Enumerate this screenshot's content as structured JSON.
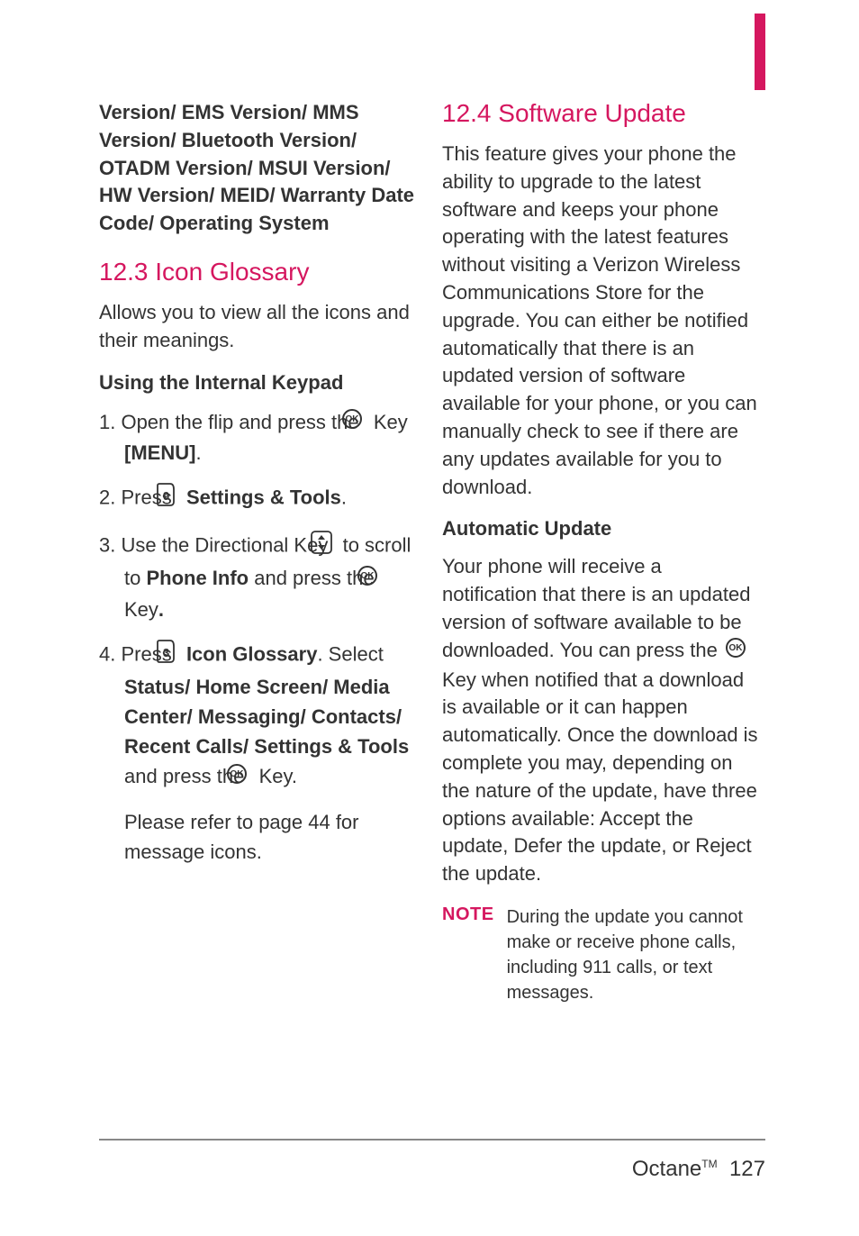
{
  "leftCol": {
    "versionList": "Version/ EMS Version/ MMS Version/ Bluetooth Version/ OTADM Version/ MSUI Version/ HW Version/ MEID/ Warranty Date Code/ Operating System",
    "heading_12_3": "12.3 Icon Glossary",
    "intro_12_3": "Allows you to view all the icons and their meanings.",
    "subhead_keypad": "Using the Internal Keypad",
    "step1_a": "1. Open the flip and press the ",
    "step1_b": " Key ",
    "step1_menu": "[MENU]",
    "step1_c": ".",
    "step2_a": "2. Press ",
    "step2_b": " Settings & Tools",
    "step2_c": ".",
    "step3_a": "3. Use the Directional Key ",
    "step3_b": " to scroll to ",
    "step3_phoneinfo": "Phone Info",
    "step3_c": " and press the ",
    "step3_d": " Key",
    "step3_e": ".",
    "step4_a": "4. Press ",
    "step4_icon_glossary": " Icon Glossary",
    "step4_b": ". Select ",
    "step4_selects": "Status/ Home Screen/ Media Center/ Messaging/ Contacts/ Recent Calls/ Settings & Tools",
    "step4_c": " and press the ",
    "step4_d": " Key.",
    "refer": "Please refer to page 44 for message icons."
  },
  "rightCol": {
    "heading_12_4": "12.4 Software Update",
    "intro_12_4": "This feature gives your phone the ability to upgrade to the latest software and keeps your phone operating with the latest features without visiting a Verizon Wireless Communications Store for the upgrade. You can either be notified automatically that there is an updated version of software available for your phone, or you can manually check to see if there are any updates available for you to download.",
    "subhead_auto": "Automatic Update",
    "auto_a": "Your phone will receive a notification that there is an updated version of software available to be downloaded. You can press the ",
    "auto_b": " Key when notified that a download is available or it can happen automatically. Once the download is complete you may, depending on the nature of the update, have three options available: Accept the update, Defer the update, or Reject the update.",
    "note_label": "NOTE",
    "note_text": "During the update you cannot make or receive phone calls, including 911 calls, or text messages."
  },
  "footer": {
    "device": "Octane",
    "tm": "TM",
    "page": "127"
  },
  "icons": {
    "ok": "OK",
    "nine": "9",
    "three": "3"
  }
}
